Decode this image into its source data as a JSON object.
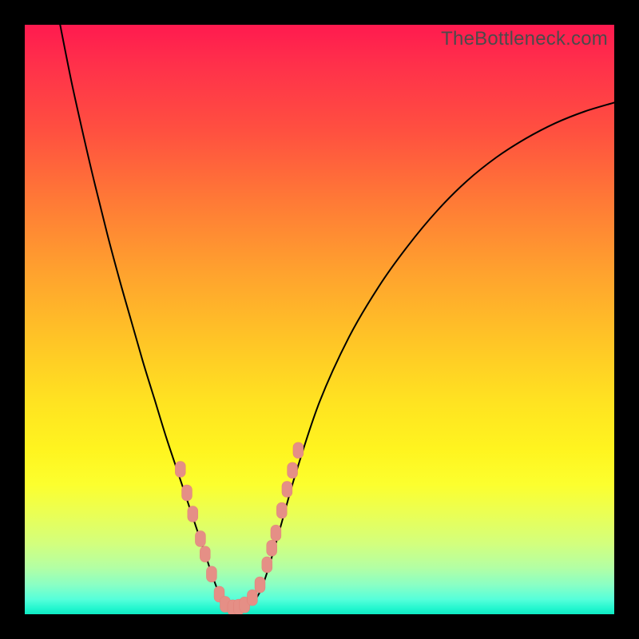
{
  "watermark": "TheBottleneck.com",
  "colors": {
    "background": "#000000",
    "curve": "#000000",
    "marker": "#e58f86"
  },
  "chart_data": {
    "type": "line",
    "title": "",
    "xlabel": "",
    "ylabel": "",
    "xlim": [
      0,
      100
    ],
    "ylim": [
      0,
      100
    ],
    "grid": false,
    "legend": false,
    "series": [
      {
        "name": "bottleneck-curve",
        "x_norm": [
          6,
          8,
          10,
          12,
          14,
          16,
          18,
          20,
          22,
          24,
          26,
          28,
          29,
          30,
          31,
          32,
          33,
          34,
          36,
          38,
          40,
          42,
          44,
          46,
          50,
          55,
          60,
          65,
          70,
          75,
          80,
          85,
          90,
          95,
          100
        ],
        "y_norm": [
          100,
          90,
          81,
          72.5,
          64.5,
          57,
          50,
          43,
          36.5,
          30,
          24,
          18,
          15,
          12,
          9,
          6,
          3.5,
          1.6,
          1.1,
          1.5,
          4,
          10,
          17,
          24,
          36,
          47,
          55.5,
          62.5,
          68.5,
          73.5,
          77.5,
          80.7,
          83.3,
          85.3,
          86.8
        ],
        "note": "x_norm / y_norm are percentages of the plot area (0–100). Minimum at x≈35."
      }
    ],
    "markers": {
      "name": "highlighted-points",
      "shape": "rounded-rect",
      "color": "#e58f86",
      "points_norm": [
        {
          "x": 26.4,
          "y": 24.6
        },
        {
          "x": 27.5,
          "y": 20.6
        },
        {
          "x": 28.5,
          "y": 17.0
        },
        {
          "x": 29.8,
          "y": 12.8
        },
        {
          "x": 30.6,
          "y": 10.2
        },
        {
          "x": 31.7,
          "y": 6.8
        },
        {
          "x": 33.0,
          "y": 3.4
        },
        {
          "x": 34.0,
          "y": 1.7
        },
        {
          "x": 35.3,
          "y": 1.1
        },
        {
          "x": 36.3,
          "y": 1.2
        },
        {
          "x": 37.3,
          "y": 1.6
        },
        {
          "x": 38.6,
          "y": 2.8
        },
        {
          "x": 39.9,
          "y": 5.0
        },
        {
          "x": 41.1,
          "y": 8.4
        },
        {
          "x": 41.9,
          "y": 11.2
        },
        {
          "x": 42.6,
          "y": 13.8
        },
        {
          "x": 43.6,
          "y": 17.6
        },
        {
          "x": 44.5,
          "y": 21.2
        },
        {
          "x": 45.4,
          "y": 24.4
        },
        {
          "x": 46.4,
          "y": 27.8
        }
      ]
    }
  }
}
